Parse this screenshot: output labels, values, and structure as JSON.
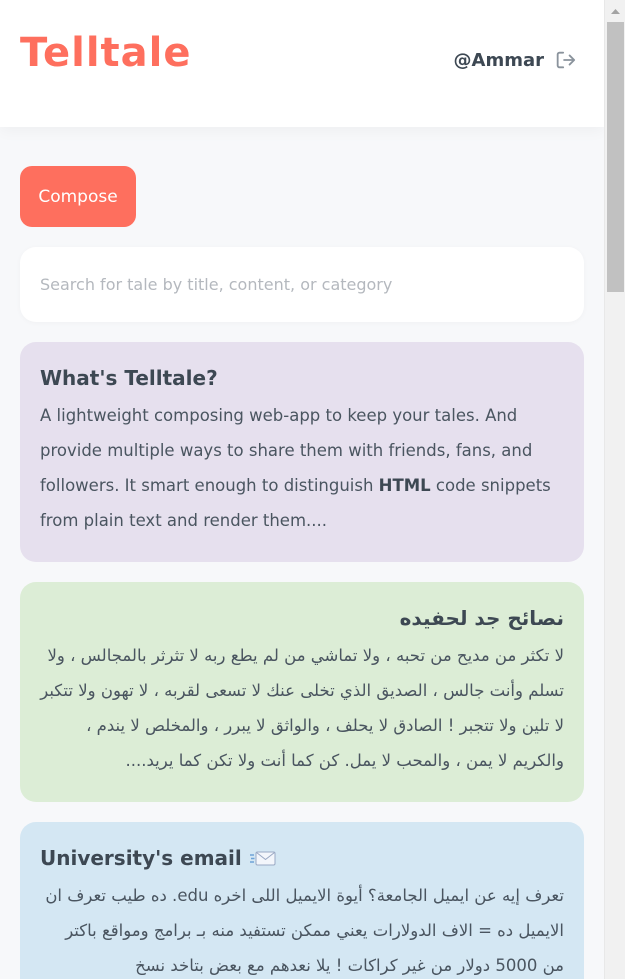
{
  "app": {
    "logo": "Telltale",
    "username": "@Ammar"
  },
  "compose": {
    "label": "Compose"
  },
  "search": {
    "placeholder": "Search for tale by title, content, or category",
    "value": ""
  },
  "cards": [
    {
      "title": "What's Telltale?",
      "body_parts": {
        "before": "A lightweight composing web-app  to keep your tales. And provide multiple ways to share them with friends, fans, and followers. It smart enough to distinguish ",
        "bold": "HTML",
        "after": " code snippets from plain text and render them...."
      },
      "color": "#e6e0ee"
    },
    {
      "title": "نصائح جد لحفيده",
      "body": "لا تكثر من مديح من تحبه ، ولا تماشي من لم يطع ربه لا تثرثر بالمجالس ، ولا تسلم وأنت جالس ، الصديق الذي تخلى عنك لا تسعى لقربه ، لا تهون ولا تتكبر لا تلين ولا تتجبر ! الصادق لا يحلف ، والواثق لا يبرر ، والمخلص لا يندم ، والكريم لا يمن ، والمحب لا يمل. كن كما أنت ولا تكن كما يريد....",
      "color": "#dcedd6"
    },
    {
      "title": "University's email",
      "title_icon": "envelope-icon",
      "body": "تعرف إيه عن ايميل الجامعة؟ أيوة الايميل اللى اخره edu.  ده طيب تعرف ان الايميل ده = الاف الدولارات يعني ممكن تستفيد منه بـ برامج ومواقع باكتر من 5000 دولار من غير كراكات ! يلا نعدهم مع بعض بتاخد نسخ",
      "color": "#d4e7f3"
    }
  ],
  "colors": {
    "brand": "#fe6f5e",
    "text": "#4a5560",
    "heading": "#3d4853"
  },
  "icons": {
    "logout": "logout-icon",
    "scroll_up": "scroll-up-arrow-icon"
  }
}
